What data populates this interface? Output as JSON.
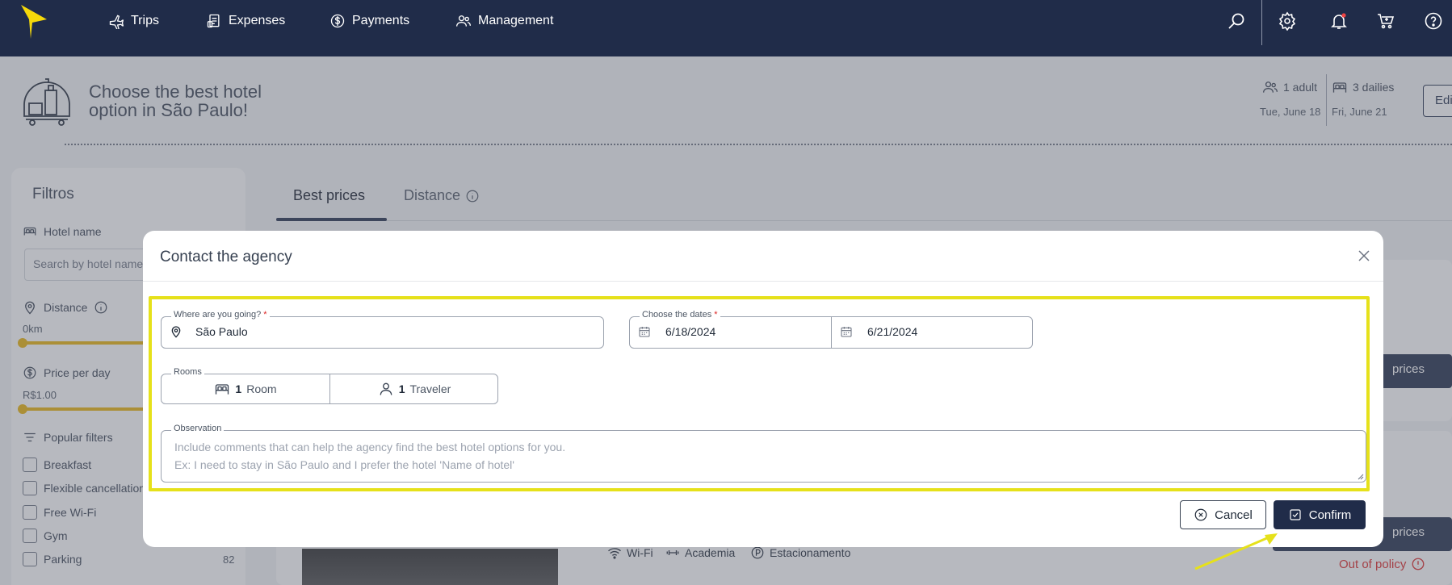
{
  "nav": {
    "items": [
      {
        "label": "Trips",
        "icon": "plane-icon"
      },
      {
        "label": "Expenses",
        "icon": "receipt-icon"
      },
      {
        "label": "Payments",
        "icon": "dollar-circle-icon"
      },
      {
        "label": "Management",
        "icon": "users-icon"
      }
    ],
    "right_icons": [
      "search-icon",
      "gear-icon",
      "bell-icon",
      "cart-icon",
      "help-icon"
    ],
    "brand_color": "#202c49",
    "logo_color": "#f5d90a"
  },
  "header": {
    "title": "Choose the best hotel option in São Paulo!",
    "guests": "1 adult",
    "nights": "3 dailies",
    "checkin": "Tue, June 18",
    "checkout": "Fri, June 21",
    "edit_label": "Edi"
  },
  "filters": {
    "title": "Filtros",
    "hotel_name_label": "Hotel name",
    "hotel_name_placeholder": "Search by hotel name",
    "distance_label": "Distance",
    "distance_value": "0km",
    "price_label": "Price per day",
    "price_value": "R$1.00",
    "popular_label": "Popular filters",
    "options": [
      {
        "label": "Breakfast",
        "count": ""
      },
      {
        "label": "Flexible cancellation",
        "count": ""
      },
      {
        "label": "Free Wi-Fi",
        "count": ""
      },
      {
        "label": "Gym",
        "count": ""
      },
      {
        "label": "Parking",
        "count": "82"
      }
    ]
  },
  "tabs": [
    {
      "label": "Best prices",
      "active": true
    },
    {
      "label": "Distance",
      "active": false
    }
  ],
  "results": {
    "price_btn_label": "prices",
    "amenities": [
      "Wi-Fi",
      "Academia",
      "Estacionamento"
    ],
    "out_of_policy": "Out of policy"
  },
  "modal": {
    "title": "Contact the agency",
    "destination": {
      "label": "Where are you going?",
      "required": "*",
      "value": "São Paulo"
    },
    "dates": {
      "label": "Choose the dates",
      "required": "*",
      "start": "6/18/2024",
      "end": "6/21/2024"
    },
    "rooms": {
      "label": "Rooms",
      "rooms_count": "1",
      "rooms_unit": "Room",
      "travelers_count": "1",
      "travelers_unit": "Traveler"
    },
    "observation": {
      "label": "Observation",
      "placeholder_line1": "Include comments that can help the agency find the best hotel options for you.",
      "placeholder_line2": "Ex: I need to stay in São Paulo and I prefer the hotel 'Name of hotel'"
    },
    "cancel_label": "Cancel",
    "confirm_label": "Confirm",
    "highlight_color": "#e6e11a"
  }
}
